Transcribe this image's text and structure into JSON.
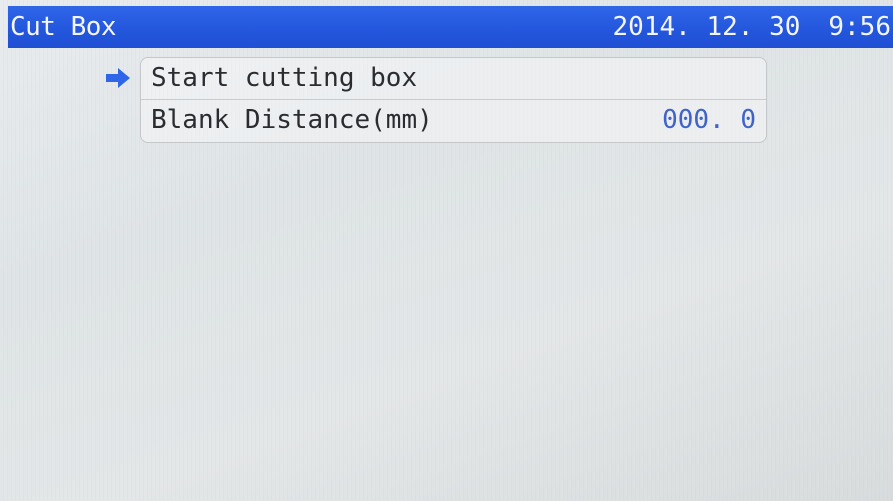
{
  "header": {
    "title": "Cut Box",
    "date": "2014. 12. 30",
    "time": "9:56"
  },
  "menu": {
    "selected_index": 0,
    "items": [
      {
        "label": "Start cutting box",
        "value": ""
      },
      {
        "label": "Blank Distance(mm)",
        "value": "000. 0"
      }
    ]
  },
  "colors": {
    "header_bg": "#2457dd",
    "header_text": "#f4f6ff",
    "pointer": "#2f66e8",
    "value_text": "#3f63c9",
    "screen_bg": "#e4e7e8"
  },
  "icons": {
    "pointer": "right-arrow-icon"
  }
}
